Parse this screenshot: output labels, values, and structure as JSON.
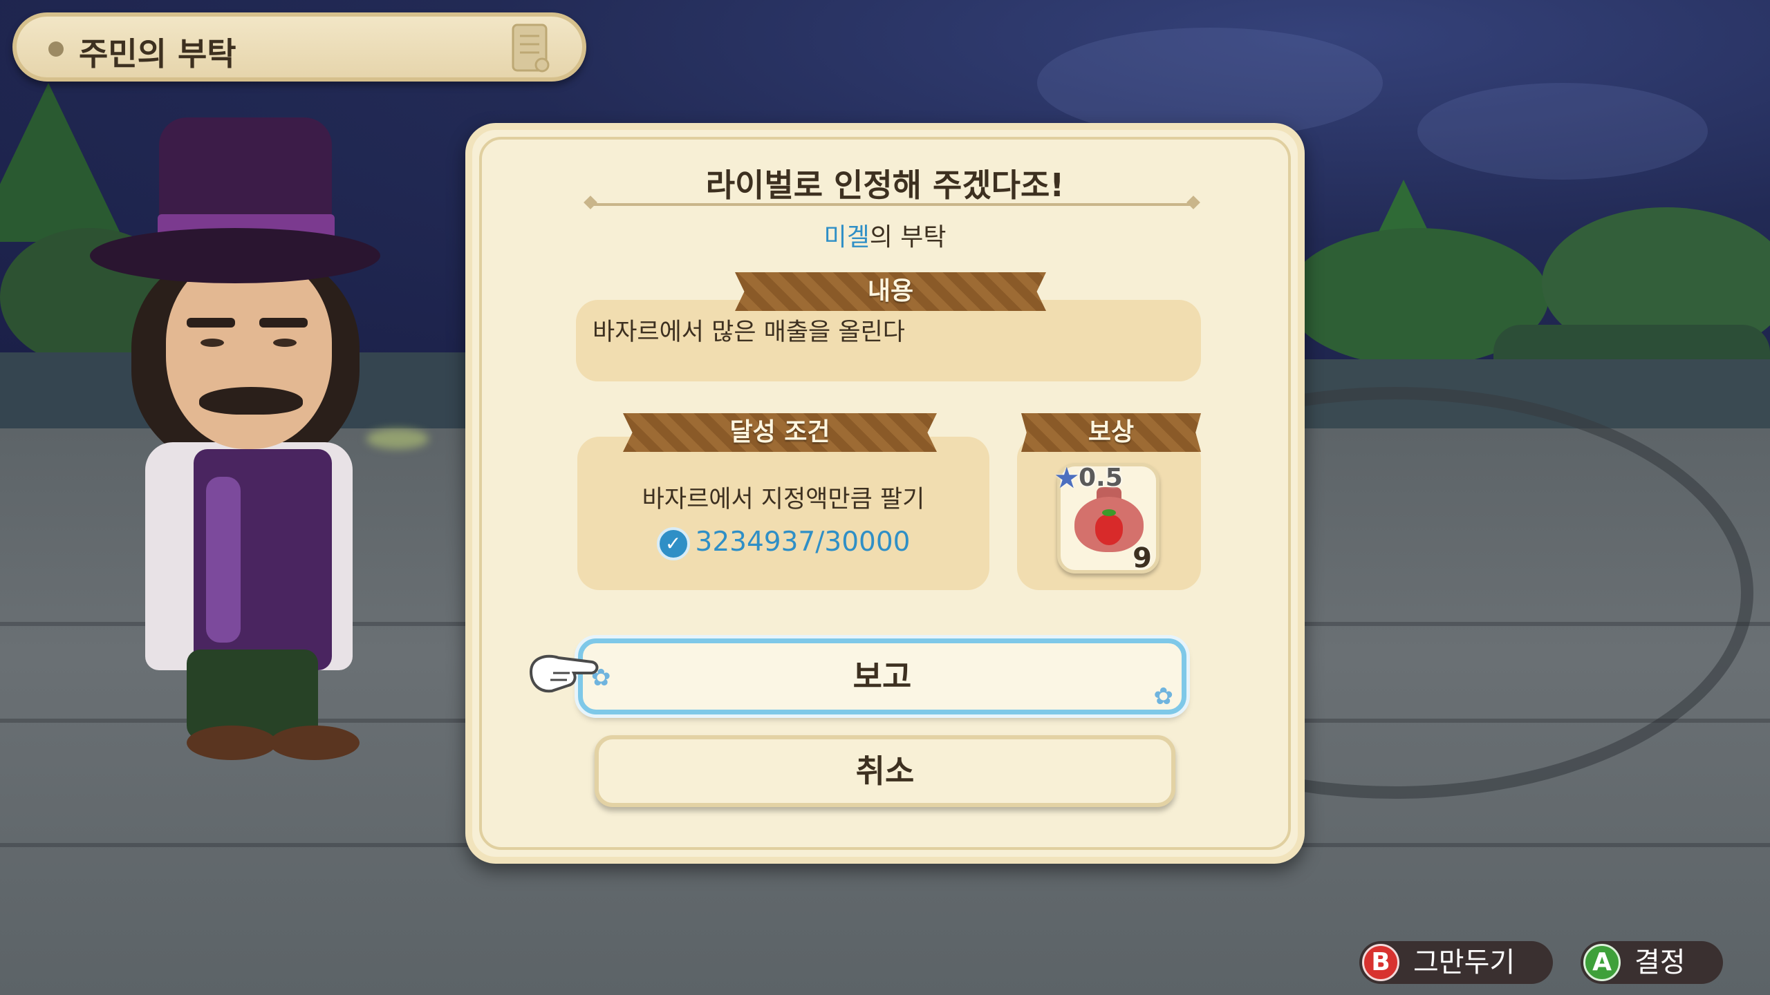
{
  "header": {
    "title": "주민의 부탁"
  },
  "dialog": {
    "title": "라이벌로 인정해 주겠다조!",
    "requester_name": "미겔",
    "requester_suffix": "의 부탁",
    "content_label": "내용",
    "content_text": "바자르에서 많은 매출을 올린다",
    "condition_label": "달성 조건",
    "condition_text": "바자르에서 지정액만큼 팔기",
    "progress": "3234937/30000",
    "reward_label": "보상",
    "reward_value": "0.5",
    "reward_count": "9",
    "report_button": "보고",
    "cancel_button": "취소"
  },
  "controls": {
    "b_key": "B",
    "b_label": "그만두기",
    "a_key": "A",
    "a_label": "결정"
  },
  "colors": {
    "accent_blue": "#2f8fc6",
    "panel": "#f1ddb0",
    "ribbon": "#8a5a28"
  },
  "icons": [
    "scroll-icon",
    "check-icon",
    "star-icon",
    "strawberry-bag-icon",
    "pointing-hand-icon",
    "flower-icon"
  ]
}
